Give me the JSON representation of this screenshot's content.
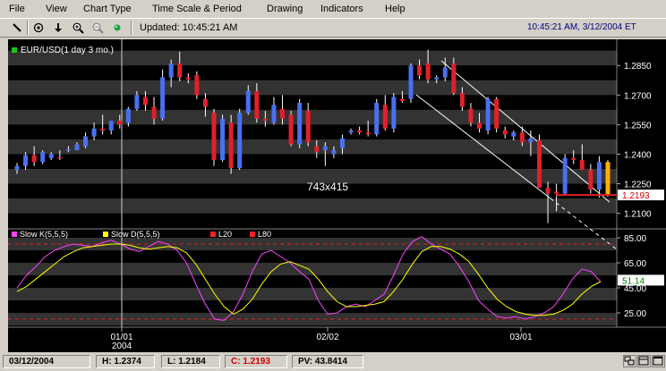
{
  "menu": {
    "items": [
      "File",
      "View",
      "Chart Type",
      "Time Scale & Period",
      "Drawing",
      "Indicators",
      "Help"
    ]
  },
  "toolbar": {
    "buttons": [
      "line-draw-icon",
      "crosshair-icon",
      "down-arrow-icon",
      "zoom-in-icon",
      "zoom-out-icon",
      "green-dot-icon"
    ],
    "updated": "Updated: 10:45:21 AM",
    "clock": "10:45:21 AM, 3/12/2004 ET"
  },
  "chart": {
    "title": "EUR/USD(1 day 3 mo.)",
    "watermark": "743x415",
    "current_price_label": "1.2193",
    "price_ticks": [
      "1.2850",
      "1.2700",
      "1.2550",
      "1.2400",
      "1.2250",
      "1.2100"
    ],
    "indicator_legend": [
      {
        "label": "Slow K(5,5,5)",
        "color": "#ff44ff"
      },
      {
        "label": "Slow D(5,5,5)",
        "color": "#ffff00"
      },
      {
        "label": "L20",
        "color": "#ff2020"
      },
      {
        "label": "L80",
        "color": "#ff2020"
      }
    ],
    "indicator_ticks": [
      "85.00",
      "65.00",
      "45.00",
      "25.00"
    ],
    "indicator_value_label": "51.14",
    "date_ticks": [
      {
        "line1": "01/01",
        "line2": "2004"
      },
      {
        "line1": "02/02",
        "line2": ""
      },
      {
        "line1": "03/01",
        "line2": ""
      }
    ]
  },
  "chart_data": [
    {
      "type": "candlestick",
      "title": "EUR/USD(1 day 3 mo.)",
      "ylim": [
        1.203,
        1.296
      ],
      "last_price": 1.2193,
      "candles": [
        {
          "o": 1.232,
          "h": 1.2355,
          "l": 1.23,
          "c": 1.234
        },
        {
          "o": 1.234,
          "h": 1.241,
          "l": 1.232,
          "c": 1.2395
        },
        {
          "o": 1.2395,
          "h": 1.244,
          "l": 1.234,
          "c": 1.236
        },
        {
          "o": 1.236,
          "h": 1.242,
          "l": 1.235,
          "c": 1.241
        },
        {
          "o": 1.238,
          "h": 1.241,
          "l": 1.237,
          "c": 1.24
        },
        {
          "o": 1.2385,
          "h": 1.242,
          "l": 1.237,
          "c": 1.238
        },
        {
          "o": 1.242,
          "h": 1.244,
          "l": 1.241,
          "c": 1.2425
        },
        {
          "o": 1.242,
          "h": 1.246,
          "l": 1.242,
          "c": 1.245
        },
        {
          "o": 1.244,
          "h": 1.251,
          "l": 1.243,
          "c": 1.249
        },
        {
          "o": 1.249,
          "h": 1.256,
          "l": 1.247,
          "c": 1.253
        },
        {
          "o": 1.253,
          "h": 1.26,
          "l": 1.25,
          "c": 1.252
        },
        {
          "o": 1.252,
          "h": 1.257,
          "l": 1.25,
          "c": 1.257
        },
        {
          "o": 1.257,
          "h": 1.26,
          "l": 1.253,
          "c": 1.255
        },
        {
          "o": 1.256,
          "h": 1.264,
          "l": 1.254,
          "c": 1.263
        },
        {
          "o": 1.263,
          "h": 1.272,
          "l": 1.262,
          "c": 1.27
        },
        {
          "o": 1.269,
          "h": 1.272,
          "l": 1.262,
          "c": 1.265
        },
        {
          "o": 1.264,
          "h": 1.269,
          "l": 1.255,
          "c": 1.258
        },
        {
          "o": 1.258,
          "h": 1.283,
          "l": 1.257,
          "c": 1.279
        },
        {
          "o": 1.279,
          "h": 1.288,
          "l": 1.274,
          "c": 1.286
        },
        {
          "o": 1.286,
          "h": 1.292,
          "l": 1.277,
          "c": 1.279
        },
        {
          "o": 1.279,
          "h": 1.281,
          "l": 1.276,
          "c": 1.278
        },
        {
          "o": 1.28,
          "h": 1.282,
          "l": 1.268,
          "c": 1.27
        },
        {
          "o": 1.268,
          "h": 1.271,
          "l": 1.259,
          "c": 1.264
        },
        {
          "o": 1.261,
          "h": 1.263,
          "l": 1.234,
          "c": 1.237
        },
        {
          "o": 1.237,
          "h": 1.26,
          "l": 1.236,
          "c": 1.258
        },
        {
          "o": 1.256,
          "h": 1.26,
          "l": 1.23,
          "c": 1.233
        },
        {
          "o": 1.233,
          "h": 1.263,
          "l": 1.232,
          "c": 1.261
        },
        {
          "o": 1.261,
          "h": 1.275,
          "l": 1.26,
          "c": 1.272
        },
        {
          "o": 1.272,
          "h": 1.276,
          "l": 1.256,
          "c": 1.258
        },
        {
          "o": 1.258,
          "h": 1.262,
          "l": 1.254,
          "c": 1.257
        },
        {
          "o": 1.256,
          "h": 1.269,
          "l": 1.255,
          "c": 1.265
        },
        {
          "o": 1.263,
          "h": 1.27,
          "l": 1.255,
          "c": 1.258
        },
        {
          "o": 1.26,
          "h": 1.262,
          "l": 1.244,
          "c": 1.245
        },
        {
          "o": 1.245,
          "h": 1.268,
          "l": 1.243,
          "c": 1.266
        },
        {
          "o": 1.262,
          "h": 1.266,
          "l": 1.244,
          "c": 1.246
        },
        {
          "o": 1.244,
          "h": 1.247,
          "l": 1.238,
          "c": 1.241
        },
        {
          "o": 1.242,
          "h": 1.246,
          "l": 1.234,
          "c": 1.244
        },
        {
          "o": 1.24,
          "h": 1.244,
          "l": 1.238,
          "c": 1.242
        },
        {
          "o": 1.243,
          "h": 1.25,
          "l": 1.24,
          "c": 1.248
        },
        {
          "o": 1.251,
          "h": 1.253,
          "l": 1.25,
          "c": 1.252
        },
        {
          "o": 1.252,
          "h": 1.254,
          "l": 1.25,
          "c": 1.251
        },
        {
          "o": 1.251,
          "h": 1.257,
          "l": 1.249,
          "c": 1.25
        },
        {
          "o": 1.25,
          "h": 1.268,
          "l": 1.249,
          "c": 1.266
        },
        {
          "o": 1.265,
          "h": 1.27,
          "l": 1.252,
          "c": 1.253
        },
        {
          "o": 1.253,
          "h": 1.271,
          "l": 1.251,
          "c": 1.269
        },
        {
          "o": 1.268,
          "h": 1.272,
          "l": 1.266,
          "c": 1.267
        },
        {
          "o": 1.268,
          "h": 1.286,
          "l": 1.266,
          "c": 1.285
        },
        {
          "o": 1.285,
          "h": 1.288,
          "l": 1.278,
          "c": 1.28
        },
        {
          "o": 1.286,
          "h": 1.293,
          "l": 1.276,
          "c": 1.278
        },
        {
          "o": 1.278,
          "h": 1.28,
          "l": 1.276,
          "c": 1.279
        },
        {
          "o": 1.279,
          "h": 1.289,
          "l": 1.277,
          "c": 1.284
        },
        {
          "o": 1.286,
          "h": 1.289,
          "l": 1.27,
          "c": 1.271
        },
        {
          "o": 1.271,
          "h": 1.274,
          "l": 1.262,
          "c": 1.264
        },
        {
          "o": 1.263,
          "h": 1.266,
          "l": 1.254,
          "c": 1.256
        },
        {
          "o": 1.256,
          "h": 1.261,
          "l": 1.251,
          "c": 1.253
        },
        {
          "o": 1.252,
          "h": 1.269,
          "l": 1.25,
          "c": 1.268
        },
        {
          "o": 1.268,
          "h": 1.269,
          "l": 1.251,
          "c": 1.253
        },
        {
          "o": 1.252,
          "h": 1.254,
          "l": 1.248,
          "c": 1.25
        },
        {
          "o": 1.249,
          "h": 1.252,
          "l": 1.247,
          "c": 1.251
        },
        {
          "o": 1.251,
          "h": 1.254,
          "l": 1.244,
          "c": 1.246
        },
        {
          "o": 1.246,
          "h": 1.252,
          "l": 1.239,
          "c": 1.248
        },
        {
          "o": 1.247,
          "h": 1.25,
          "l": 1.223,
          "c": 1.223
        },
        {
          "o": 1.223,
          "h": 1.226,
          "l": 1.205,
          "c": 1.22
        },
        {
          "o": 1.221,
          "h": 1.225,
          "l": 1.211,
          "c": 1.22
        },
        {
          "o": 1.22,
          "h": 1.24,
          "l": 1.219,
          "c": 1.238
        },
        {
          "o": 1.238,
          "h": 1.242,
          "l": 1.235,
          "c": 1.237
        },
        {
          "o": 1.237,
          "h": 1.245,
          "l": 1.233,
          "c": 1.232
        },
        {
          "o": 1.232,
          "h": 1.235,
          "l": 1.22,
          "c": 1.222
        },
        {
          "o": 1.222,
          "h": 1.239,
          "l": 1.218,
          "c": 1.236
        },
        {
          "o": 1.236,
          "h": 1.237,
          "l": 1.2184,
          "c": 1.2193
        }
      ]
    },
    {
      "type": "line",
      "title": "",
      "ylim": [
        15,
        90
      ],
      "series": [
        {
          "name": "Slow K(5,5,5)",
          "values": [
            45,
            55,
            62,
            70,
            75,
            78,
            80,
            79,
            78,
            81,
            83,
            80,
            76,
            74,
            78,
            82,
            80,
            75,
            65,
            48,
            32,
            20,
            19,
            26,
            40,
            58,
            72,
            75,
            70,
            65,
            58,
            52,
            35,
            24,
            25,
            30,
            32,
            30,
            35,
            40,
            55,
            72,
            82,
            86,
            80,
            76,
            72,
            62,
            50,
            35,
            28,
            22,
            21,
            22,
            20,
            22,
            25,
            30,
            40,
            52,
            60,
            58,
            50
          ]
        },
        {
          "name": "Slow D(5,5,5)",
          "values": [
            42,
            46,
            52,
            58,
            64,
            70,
            74,
            77,
            78,
            79,
            80,
            80,
            79,
            77,
            76,
            77,
            78,
            77,
            73,
            64,
            52,
            40,
            30,
            24,
            28,
            36,
            48,
            58,
            64,
            66,
            63,
            60,
            52,
            42,
            34,
            30,
            30,
            31,
            32,
            34,
            42,
            52,
            64,
            74,
            78,
            78,
            76,
            72,
            66,
            56,
            45,
            36,
            30,
            26,
            24,
            23,
            23,
            24,
            27,
            32,
            40,
            46,
            50
          ]
        },
        {
          "name": "L20",
          "values": [
            20
          ]
        },
        {
          "name": "L80",
          "values": [
            80
          ]
        }
      ],
      "last_value": 51.14
    }
  ],
  "status": {
    "date": "03/12/2004",
    "high": "H: 1.2374",
    "low": "L: 1.2184",
    "close": "C: 1.2193",
    "pv": "PV: 43.8414"
  }
}
